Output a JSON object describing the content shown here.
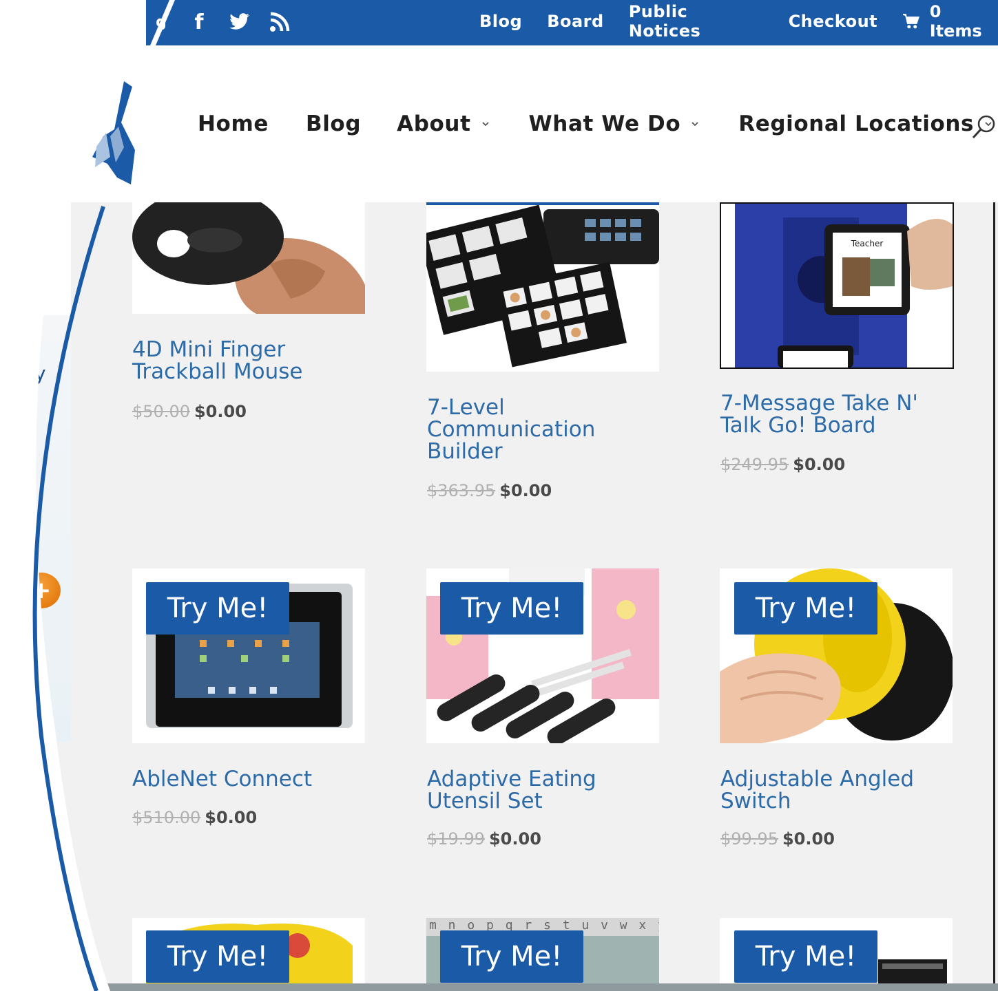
{
  "colors": {
    "brand_blue": "#1a5aa6",
    "link_blue": "#2d6aa8",
    "accent_orange": "#e57d12",
    "text_dark": "#1f1f1f"
  },
  "topbar": {
    "social_icons": [
      "facebook-icon",
      "twitter-icon",
      "rss-icon"
    ],
    "links": [
      "Blog",
      "Board",
      "Public Notices",
      "Checkout"
    ],
    "cart_icon": "shopping-cart-icon",
    "cart_label": "0 Items"
  },
  "nav": {
    "items": [
      {
        "label": "Home",
        "has_dropdown": false
      },
      {
        "label": "Blog",
        "has_dropdown": false
      },
      {
        "label": "About",
        "has_dropdown": true
      },
      {
        "label": "What We Do",
        "has_dropdown": true
      },
      {
        "label": "Regional Locations",
        "has_dropdown": true
      }
    ],
    "search_icon": "search-icon"
  },
  "sidebar": {
    "partial_text": "y",
    "plus_icon": "plus-icon"
  },
  "products": [
    {
      "title": "4D Mini Finger Trackball Mouse",
      "old_price": "$50.00",
      "new_price": "$0.00",
      "button": ""
    },
    {
      "title": "7-Level Communication Builder",
      "old_price": "$363.95",
      "new_price": "$0.00",
      "button": ""
    },
    {
      "title": "7-Message Take N' Talk Go! Board",
      "old_price": "$249.95",
      "new_price": "$0.00",
      "button": ""
    },
    {
      "title": "AbleNet Connect",
      "old_price": "$510.00",
      "new_price": "$0.00",
      "button": "Try Me!"
    },
    {
      "title": "Adaptive Eating Utensil Set",
      "old_price": "$19.99",
      "new_price": "$0.00",
      "button": "Try Me!"
    },
    {
      "title": "Adjustable Angled Switch",
      "old_price": "$99.95",
      "new_price": "$0.00",
      "button": "Try Me!"
    },
    {
      "title": "",
      "old_price": "",
      "new_price": "",
      "button": "Try Me!"
    },
    {
      "title": "",
      "old_price": "",
      "new_price": "",
      "button": "Try Me!"
    },
    {
      "title": "",
      "old_price": "",
      "new_price": "",
      "button": "Try Me!"
    }
  ],
  "thumb_texts": {
    "teacher_card": "Teacher",
    "alphabet_strip": "m n o p q r s t u v w x y"
  }
}
